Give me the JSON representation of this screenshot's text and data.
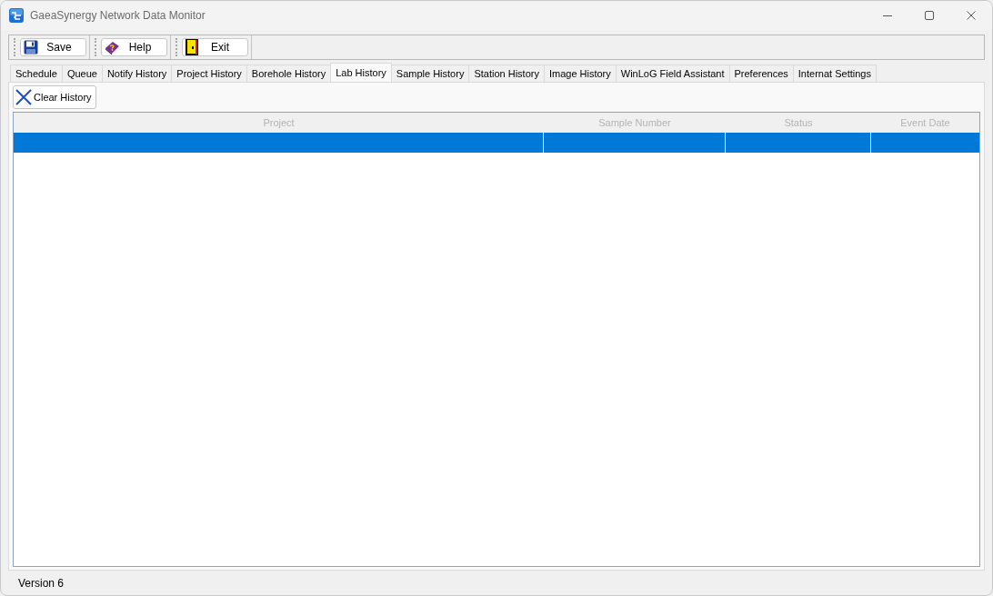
{
  "window": {
    "title": "GaeaSynergy Network Data Monitor"
  },
  "toolbar": {
    "buttons": [
      {
        "label": "Save"
      },
      {
        "label": "Help"
      },
      {
        "label": "Exit"
      }
    ]
  },
  "tabs": [
    {
      "label": "Schedule",
      "selected": false
    },
    {
      "label": "Queue",
      "selected": false
    },
    {
      "label": "Notify History",
      "selected": false
    },
    {
      "label": "Project History",
      "selected": false
    },
    {
      "label": "Borehole History",
      "selected": false
    },
    {
      "label": "Lab History",
      "selected": true
    },
    {
      "label": "Sample History",
      "selected": false
    },
    {
      "label": "Station History",
      "selected": false
    },
    {
      "label": "Image History",
      "selected": false
    },
    {
      "label": "WinLoG Field Assistant",
      "selected": false
    },
    {
      "label": "Preferences",
      "selected": false
    },
    {
      "label": "Internat Settings",
      "selected": false
    }
  ],
  "panel": {
    "buttons": [
      {
        "label": "Clear History"
      }
    ]
  },
  "table": {
    "columns": [
      "Project",
      "Sample Number",
      "Status",
      "Event Date"
    ],
    "rows": [
      {
        "selected": true
      }
    ]
  },
  "status_bar": {
    "text": "Version 6"
  }
}
